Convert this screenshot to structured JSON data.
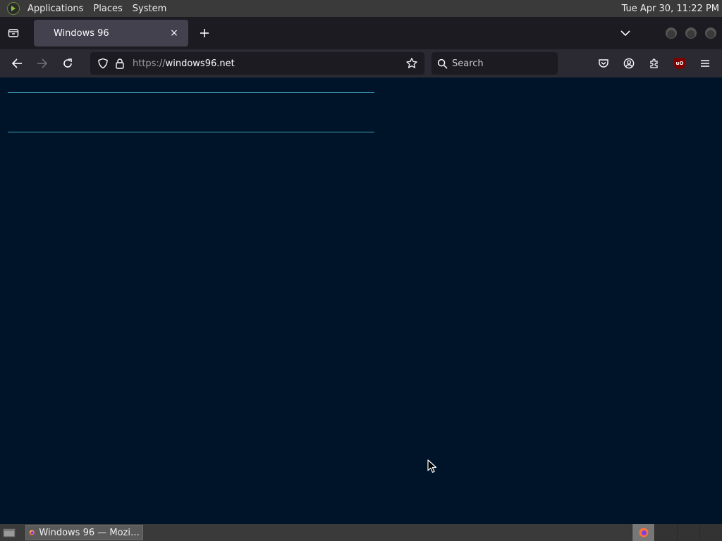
{
  "top_panel": {
    "menus": [
      "Applications",
      "Places",
      "System"
    ],
    "clock": "Tue Apr 30, 11:22 PM"
  },
  "browser": {
    "tab": {
      "title": "Windows 96",
      "close": "×"
    },
    "url": {
      "scheme": "https://",
      "host": "windows96.net"
    },
    "search_placeholder": "Search"
  },
  "taskbar": {
    "window_button": "Windows 96 — Mozi…"
  },
  "colors": {
    "page_background": "#001429",
    "content_line": "#3aa0b8",
    "toolbar": "#2b2a33",
    "tabstrip": "#1c1b22"
  }
}
